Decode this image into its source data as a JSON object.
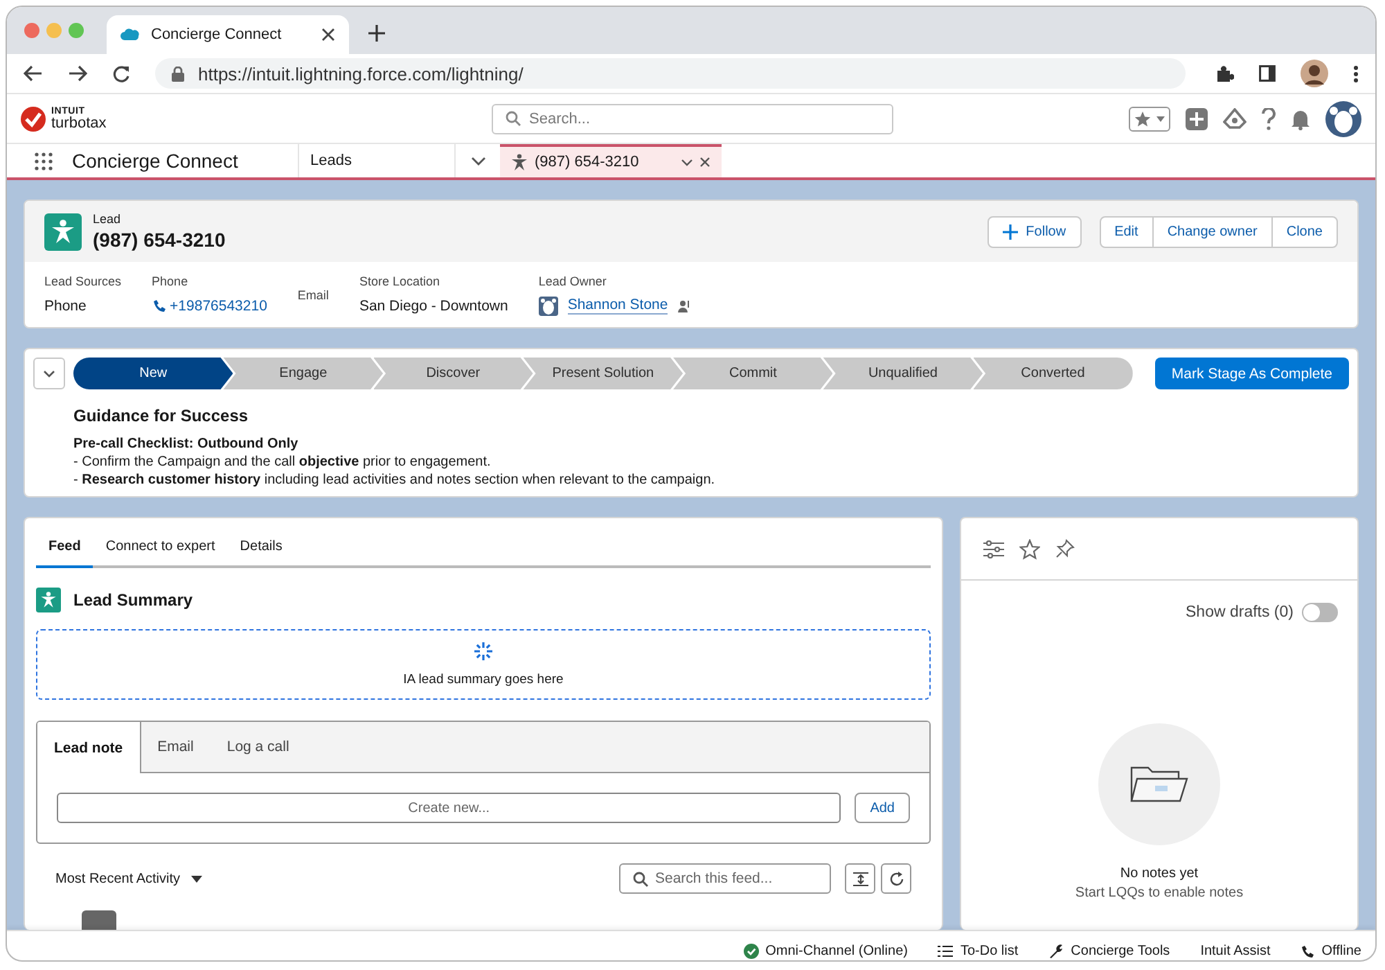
{
  "browser": {
    "tab_title": "Concierge Connect",
    "url": "https://intuit.lightning.force.com/lightning/"
  },
  "app": {
    "logo_top": "INTUIT",
    "logo_bottom": "turbotax",
    "search_placeholder": "Search..."
  },
  "nav": {
    "app_name": "Concierge Connect",
    "object": "Leads",
    "tabs": [
      {
        "label": "(987) 654-3210",
        "selected": true
      }
    ]
  },
  "record": {
    "type": "Lead",
    "title": "(987) 654-3210",
    "follow": "Follow",
    "button_group": [
      "Edit",
      "Change owner",
      "Clone"
    ],
    "fields": [
      {
        "label": "Lead Sources",
        "value": "Phone",
        "kind": "text"
      },
      {
        "label": "Phone",
        "value": "+19876543210",
        "kind": "phone"
      },
      {
        "label": "Email",
        "kind": "text"
      },
      {
        "label": "Store Location",
        "value": "San Diego - Downtown",
        "kind": "text"
      },
      {
        "label": "Lead Owner",
        "value": "Shannon Stone",
        "kind": "user"
      }
    ]
  },
  "path": {
    "stages": [
      {
        "label": "New",
        "selected": true
      },
      {
        "label": "Engage",
        "selected": false
      },
      {
        "label": "Discover",
        "selected": false
      },
      {
        "label": "Present Solution",
        "selected": false
      },
      {
        "label": "Commit",
        "selected": false
      },
      {
        "label": "Unqualified",
        "selected": false
      },
      {
        "label": "Converted",
        "selected": false
      }
    ],
    "complete_button": "Mark Stage As Complete",
    "guidance_title": "Guidance for Success",
    "checklist_title": "Pre-call Checklist: Outbound Only",
    "lines": [
      "- Confirm the Campaign and the call **objective** prior to engagement.",
      "- **Research customer history** including lead activities and notes section when relevant to the campaign."
    ]
  },
  "feed": {
    "tabs": [
      {
        "label": "Feed",
        "selected": true
      },
      {
        "label": "Connect to expert",
        "selected": false
      },
      {
        "label": "Details",
        "selected": false
      }
    ],
    "summary_title": "Lead Summary",
    "summary_placeholder": "IA lead summary goes here",
    "composer_tabs": [
      {
        "label": "Lead note",
        "selected": true
      },
      {
        "label": "Email",
        "selected": false
      },
      {
        "label": "Log a call",
        "selected": false
      }
    ],
    "composer_placeholder": "Create new...",
    "add_button": "Add",
    "sort": "Most Recent Activity",
    "search_placeholder": "Search this feed..."
  },
  "notes": {
    "drafts_label": "Show drafts (0)",
    "drafts_on": false,
    "empty_title": "No notes yet",
    "empty_hint": "Start LQQs to enable notes"
  },
  "status_bar": [
    {
      "label": "Omni-Channel (Online)",
      "kind": "online"
    },
    {
      "label": "To-Do list",
      "kind": "list"
    },
    {
      "label": "Concierge Tools",
      "kind": "wrench"
    },
    {
      "label": "Intuit Assist",
      "kind": "plain"
    },
    {
      "label": "Offline",
      "kind": "phone"
    }
  ]
}
